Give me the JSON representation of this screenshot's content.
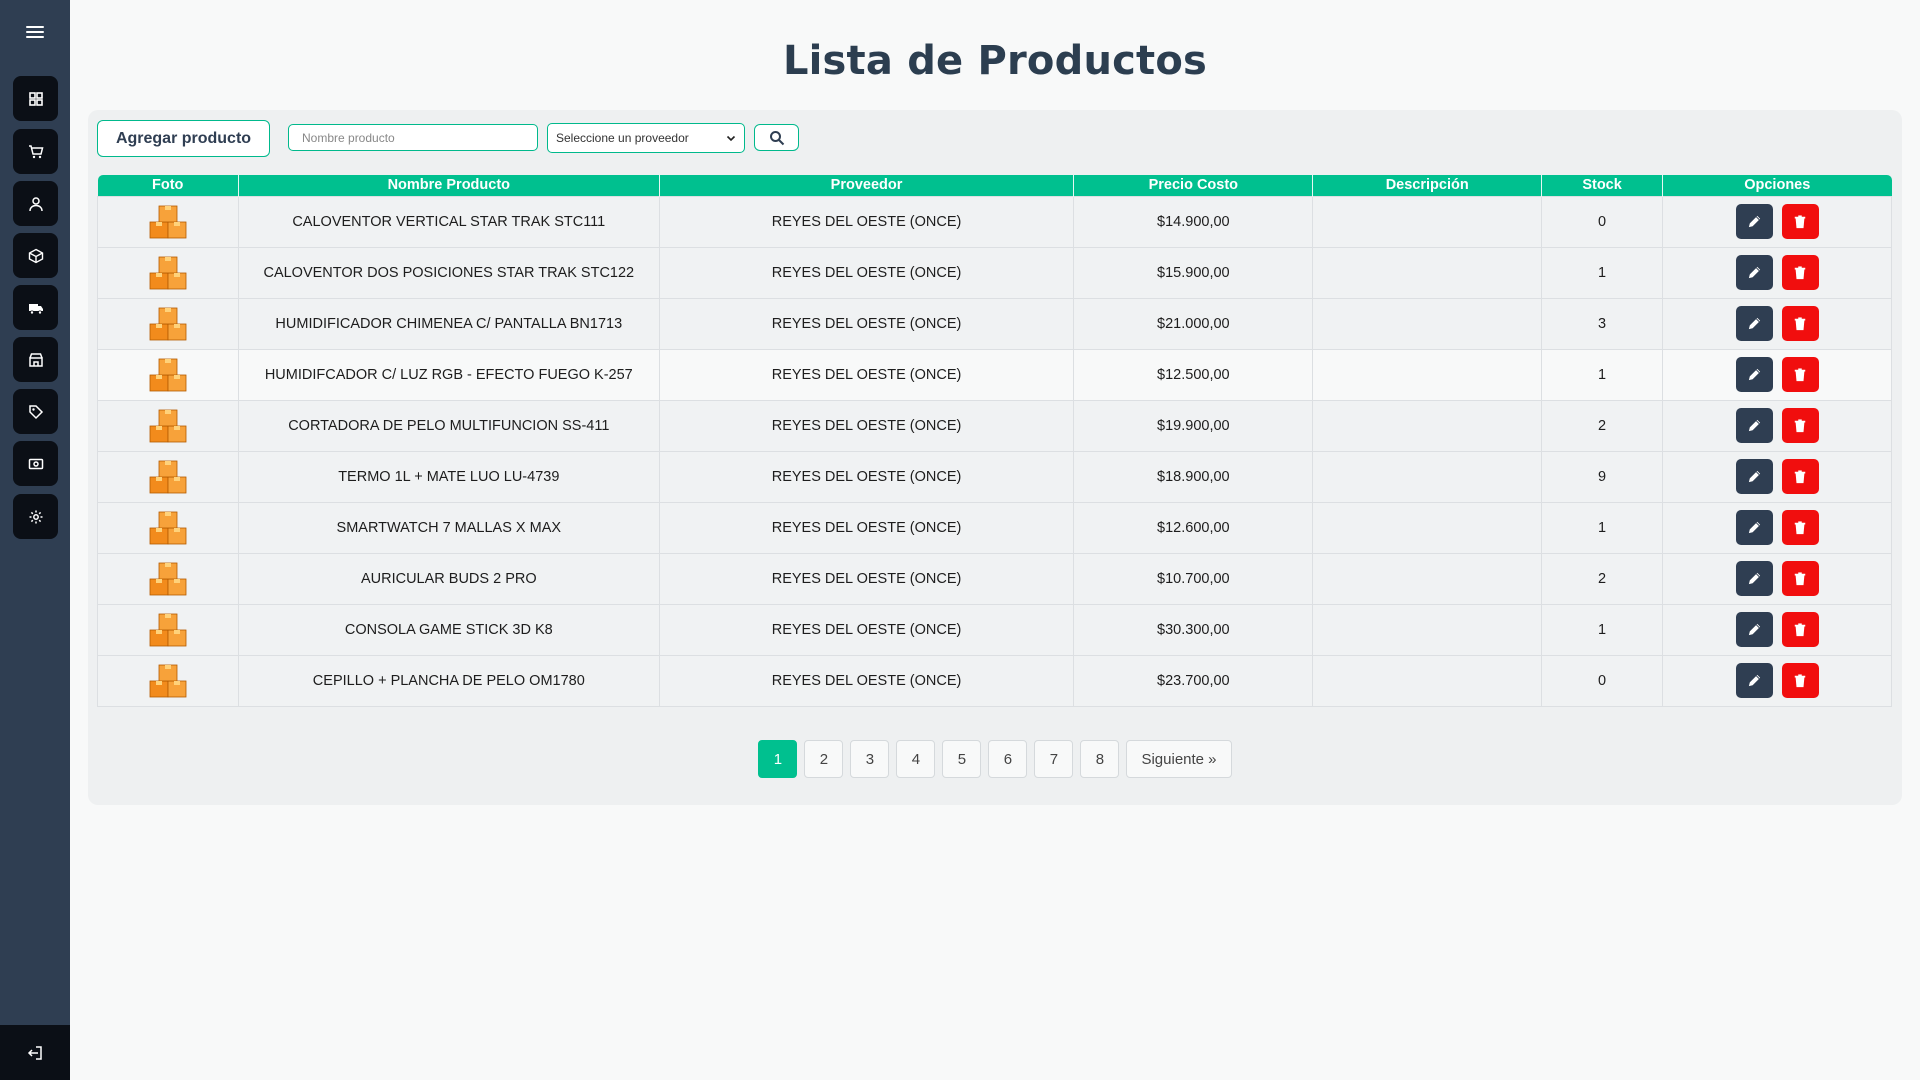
{
  "page": {
    "title": "Lista de Productos"
  },
  "toolbar": {
    "add_label": "Agregar producto",
    "search_placeholder": "Nombre producto",
    "supplier_selected": "Seleccione un proveedor"
  },
  "sidebar": {
    "items": [
      {
        "icon": "dashboard-icon"
      },
      {
        "icon": "cart-icon"
      },
      {
        "icon": "user-icon"
      },
      {
        "icon": "box-icon"
      },
      {
        "icon": "truck-icon"
      },
      {
        "icon": "store-icon"
      },
      {
        "icon": "tag-icon"
      },
      {
        "icon": "money-icon"
      },
      {
        "icon": "gear-icon"
      }
    ],
    "logout_icon": "logout-icon"
  },
  "table": {
    "headers": [
      "Foto",
      "Nombre Producto",
      "Proveedor",
      "Precio Costo",
      "Descripción",
      "Stock",
      "Opciones"
    ],
    "rows": [
      {
        "name": "CALOVENTOR VERTICAL STAR TRAK STC111",
        "supplier": "REYES DEL OESTE (ONCE)",
        "price": "$14.900,00",
        "description": "",
        "stock": "0"
      },
      {
        "name": "CALOVENTOR DOS POSICIONES STAR TRAK STC122",
        "supplier": "REYES DEL OESTE (ONCE)",
        "price": "$15.900,00",
        "description": "",
        "stock": "1"
      },
      {
        "name": "HUMIDIFICADOR CHIMENEA C/ PANTALLA BN1713",
        "supplier": "REYES DEL OESTE (ONCE)",
        "price": "$21.000,00",
        "description": "",
        "stock": "3"
      },
      {
        "name": "HUMIDIFCADOR C/ LUZ RGB - EFECTO FUEGO K-257",
        "supplier": "REYES DEL OESTE (ONCE)",
        "price": "$12.500,00",
        "description": "",
        "stock": "1"
      },
      {
        "name": "CORTADORA DE PELO MULTIFUNCION SS-411",
        "supplier": "REYES DEL OESTE (ONCE)",
        "price": "$19.900,00",
        "description": "",
        "stock": "2"
      },
      {
        "name": "TERMO 1L + MATE LUO LU-4739",
        "supplier": "REYES DEL OESTE (ONCE)",
        "price": "$18.900,00",
        "description": "",
        "stock": "9"
      },
      {
        "name": "SMARTWATCH 7 MALLAS X MAX",
        "supplier": "REYES DEL OESTE (ONCE)",
        "price": "$12.600,00",
        "description": "",
        "stock": "1"
      },
      {
        "name": "AURICULAR BUDS 2 PRO",
        "supplier": "REYES DEL OESTE (ONCE)",
        "price": "$10.700,00",
        "description": "",
        "stock": "2"
      },
      {
        "name": "CONSOLA GAME STICK 3D K8",
        "supplier": "REYES DEL OESTE (ONCE)",
        "price": "$30.300,00",
        "description": "",
        "stock": "1"
      },
      {
        "name": "CEPILLO + PLANCHA DE PELO OM1780",
        "supplier": "REYES DEL OESTE (ONCE)",
        "price": "$23.700,00",
        "description": "",
        "stock": "0"
      }
    ]
  },
  "pagination": {
    "pages": [
      "1",
      "2",
      "3",
      "4",
      "5",
      "6",
      "7",
      "8"
    ],
    "active": "1",
    "next_label": "Siguiente »"
  },
  "colors": {
    "accent": "#00c08f",
    "sidebar": "#2f3e52",
    "sidebar_button": "#0b0f16",
    "title": "#2c3e50",
    "delete": "#f10e0e",
    "edit": "#2f3e52"
  }
}
